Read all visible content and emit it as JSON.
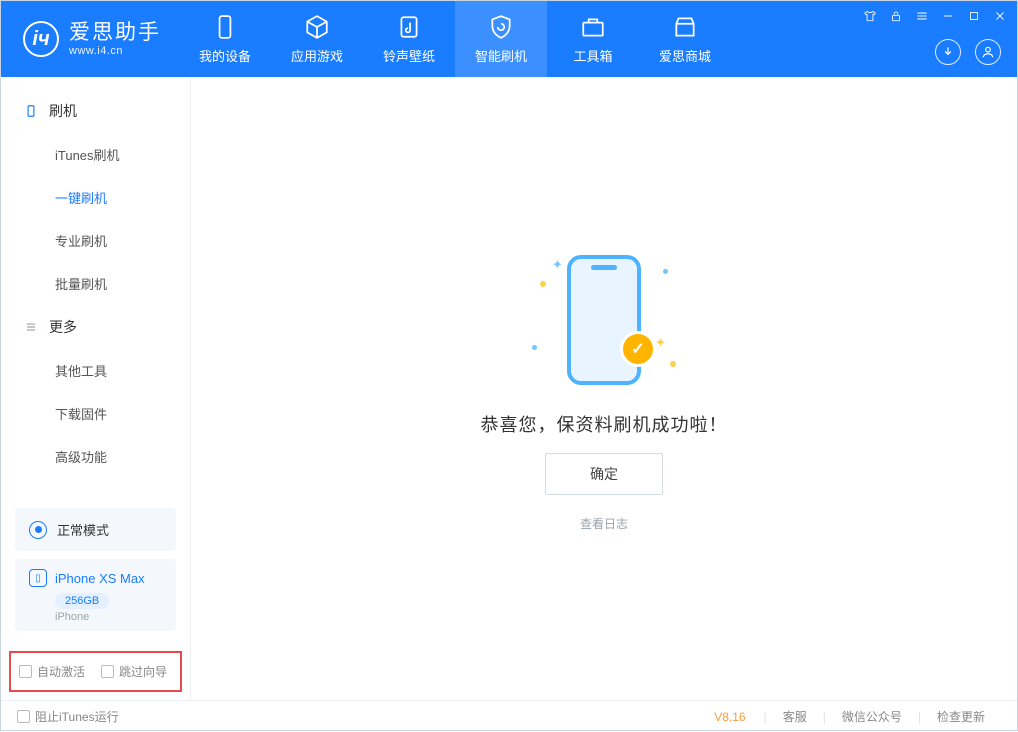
{
  "app": {
    "title": "爱思助手",
    "subtitle": "www.i4.cn"
  },
  "tabs": [
    {
      "label": "我的设备",
      "icon": "device"
    },
    {
      "label": "应用游戏",
      "icon": "cube"
    },
    {
      "label": "铃声壁纸",
      "icon": "music-file"
    },
    {
      "label": "智能刷机",
      "icon": "shield-refresh",
      "active": true
    },
    {
      "label": "工具箱",
      "icon": "briefcase"
    },
    {
      "label": "爱思商城",
      "icon": "store"
    }
  ],
  "sidebar": {
    "group1": {
      "label": "刷机",
      "items": [
        {
          "label": "iTunes刷机"
        },
        {
          "label": "一键刷机",
          "active": true
        },
        {
          "label": "专业刷机"
        },
        {
          "label": "批量刷机"
        }
      ]
    },
    "group2": {
      "label": "更多",
      "items": [
        {
          "label": "其他工具"
        },
        {
          "label": "下载固件"
        },
        {
          "label": "高级功能"
        }
      ]
    }
  },
  "device": {
    "mode": "正常模式",
    "name": "iPhone XS Max",
    "storage": "256GB",
    "type": "iPhone"
  },
  "options": {
    "autoActivate": "自动激活",
    "skipGuide": "跳过向导"
  },
  "main": {
    "successTitle": "恭喜您，保资料刷机成功啦！",
    "confirm": "确定",
    "viewLog": "查看日志"
  },
  "footer": {
    "blockItunes": "阻止iTunes运行",
    "version": "V8.16",
    "links": [
      "客服",
      "微信公众号",
      "检查更新"
    ]
  }
}
